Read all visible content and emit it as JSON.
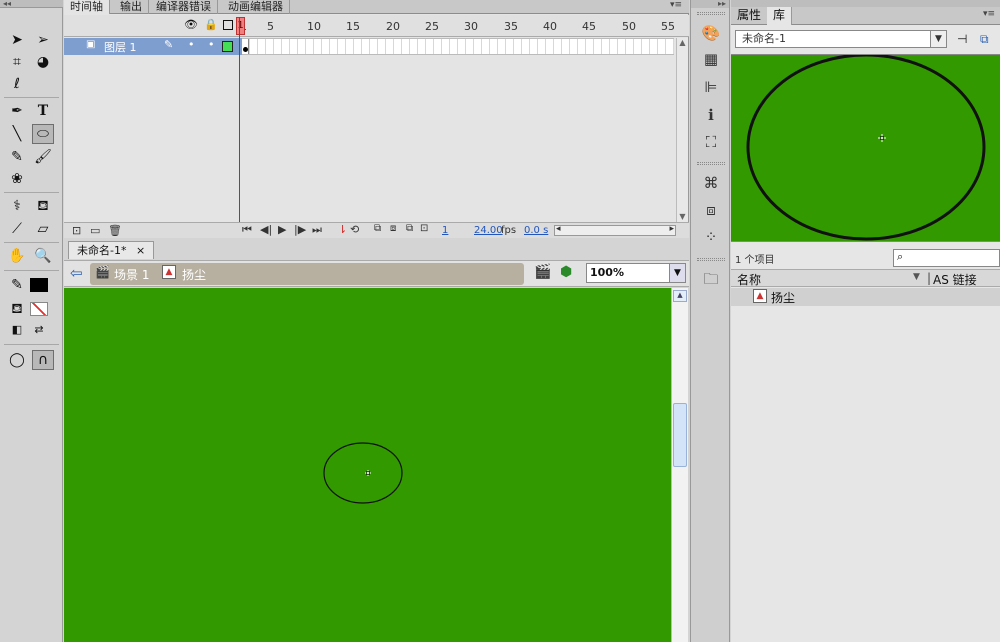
{
  "timeline": {
    "tabs": [
      "时间轴",
      "输出",
      "编译器错误",
      "动画编辑器"
    ],
    "frame_numbers": [
      "1",
      "5",
      "10",
      "15",
      "20",
      "25",
      "30",
      "35",
      "40",
      "45",
      "50",
      "55"
    ],
    "layer_name": "图层 1",
    "current_frame": "1",
    "frame_rate": "24.00",
    "fps_unit": "fps",
    "elapsed": "0.0 s"
  },
  "stage": {
    "doc_tab": "未命名-1*",
    "close_glyph": "×",
    "scene_label": "场景 1",
    "symbol_label": "扬尘",
    "zoom": "100%",
    "background_color": "#339900"
  },
  "library": {
    "tabs": [
      "属性",
      "库"
    ],
    "document": "未命名-1",
    "item_count": "1 个项目",
    "col_name": "名称",
    "col_linkage": "AS 链接",
    "items": [
      "扬尘"
    ]
  },
  "icons": {
    "tools": [
      "selection-icon",
      "subselection-icon",
      "free-transform-icon",
      "3d-rotation-icon",
      "lasso-icon",
      "pen-icon",
      "text-icon",
      "line-icon",
      "oval-icon",
      "pencil-icon",
      "brush-icon",
      "deco-icon",
      "bone-icon",
      "paint-bucket-icon",
      "eyedropper-icon",
      "eraser-icon",
      "hand-icon",
      "zoom-icon"
    ]
  }
}
